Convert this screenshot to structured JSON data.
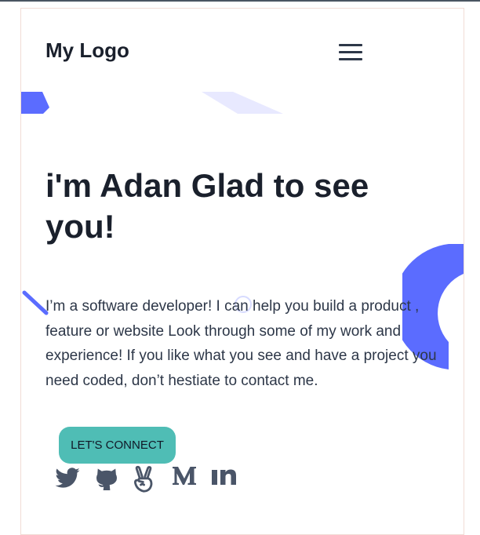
{
  "header": {
    "logo_text": "My Logo",
    "menu_icon": "hamburger-menu-icon"
  },
  "hero": {
    "title": "i'm Adan Glad to see you!",
    "description": "I’m a software developer! I can help you build a product , feature or website Look through some of my work and experience! If you like what you see and have a project you need coded, don’t hestiate to contact me.",
    "cta_label": "LET'S CONNECT"
  },
  "socials": [
    {
      "icon": "twitter-icon"
    },
    {
      "icon": "github-icon"
    },
    {
      "icon": "angellist-icon"
    },
    {
      "icon": "medium-icon"
    },
    {
      "icon": "linkedin-icon"
    }
  ],
  "colors": {
    "accent_blue": "#5b6cff",
    "accent_light": "#e8e9ff",
    "cta_teal": "#4fbdb5",
    "text_dark": "#1a202c",
    "icon_slate": "#4a5568"
  }
}
